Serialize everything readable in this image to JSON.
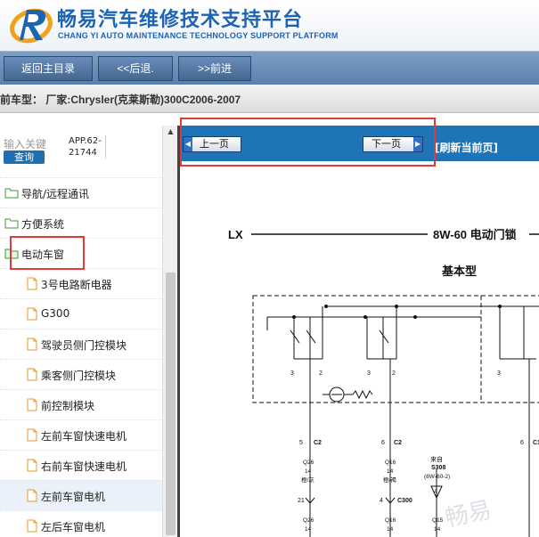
{
  "header": {
    "title_cn": "畅易汽车维修技术支持平台",
    "title_en": "CHANG YI AUTO MAINTENANCE TECHNOLOGY SUPPORT PLATFORM"
  },
  "toolbar": {
    "home_label": "返回主目录",
    "back_label": "<<后退.",
    "forward_label": ">>前进"
  },
  "info": {
    "vehicle_text": "前车型： 厂家:Chrysler(克莱斯勒)300C2006-2007"
  },
  "search": {
    "placeholder": "输入关键",
    "button_label": "查询",
    "result_line1": "APP.62-",
    "result_line2": "21744"
  },
  "tree": {
    "items": [
      {
        "label": "导航/远程通讯",
        "type": "folder"
      },
      {
        "label": "方便系统",
        "type": "folder"
      },
      {
        "label": "电动车窗",
        "type": "folder-open"
      },
      {
        "label": "3号电路断电器",
        "type": "doc"
      },
      {
        "label": "G300",
        "type": "doc"
      },
      {
        "label": "驾驶员侧门控模块",
        "type": "doc"
      },
      {
        "label": "乘客侧门控模块",
        "type": "doc"
      },
      {
        "label": "前控制模块",
        "type": "doc"
      },
      {
        "label": "左前车窗快速电机",
        "type": "doc"
      },
      {
        "label": "右前车窗快速电机",
        "type": "doc"
      },
      {
        "label": "左前车窗电机",
        "type": "doc",
        "selected": true
      },
      {
        "label": "左后车窗电机",
        "type": "doc"
      }
    ]
  },
  "content": {
    "prev_label": "上一页",
    "next_label": "下一页",
    "refresh_label": "[刷新当前页]"
  },
  "diagram": {
    "model": "LX",
    "page_title": "8W-60 电动门锁",
    "subtitle": "基本型",
    "from_label": "来自",
    "splice": "S308",
    "splice_ref": "(8W-60-2)",
    "watermark": "畅易"
  },
  "colors": {
    "brand_blue": "#1b63b3",
    "toolbar": "#5a80ac",
    "content_bar": "#1f74b5",
    "highlight_red": "#e03a3a"
  }
}
